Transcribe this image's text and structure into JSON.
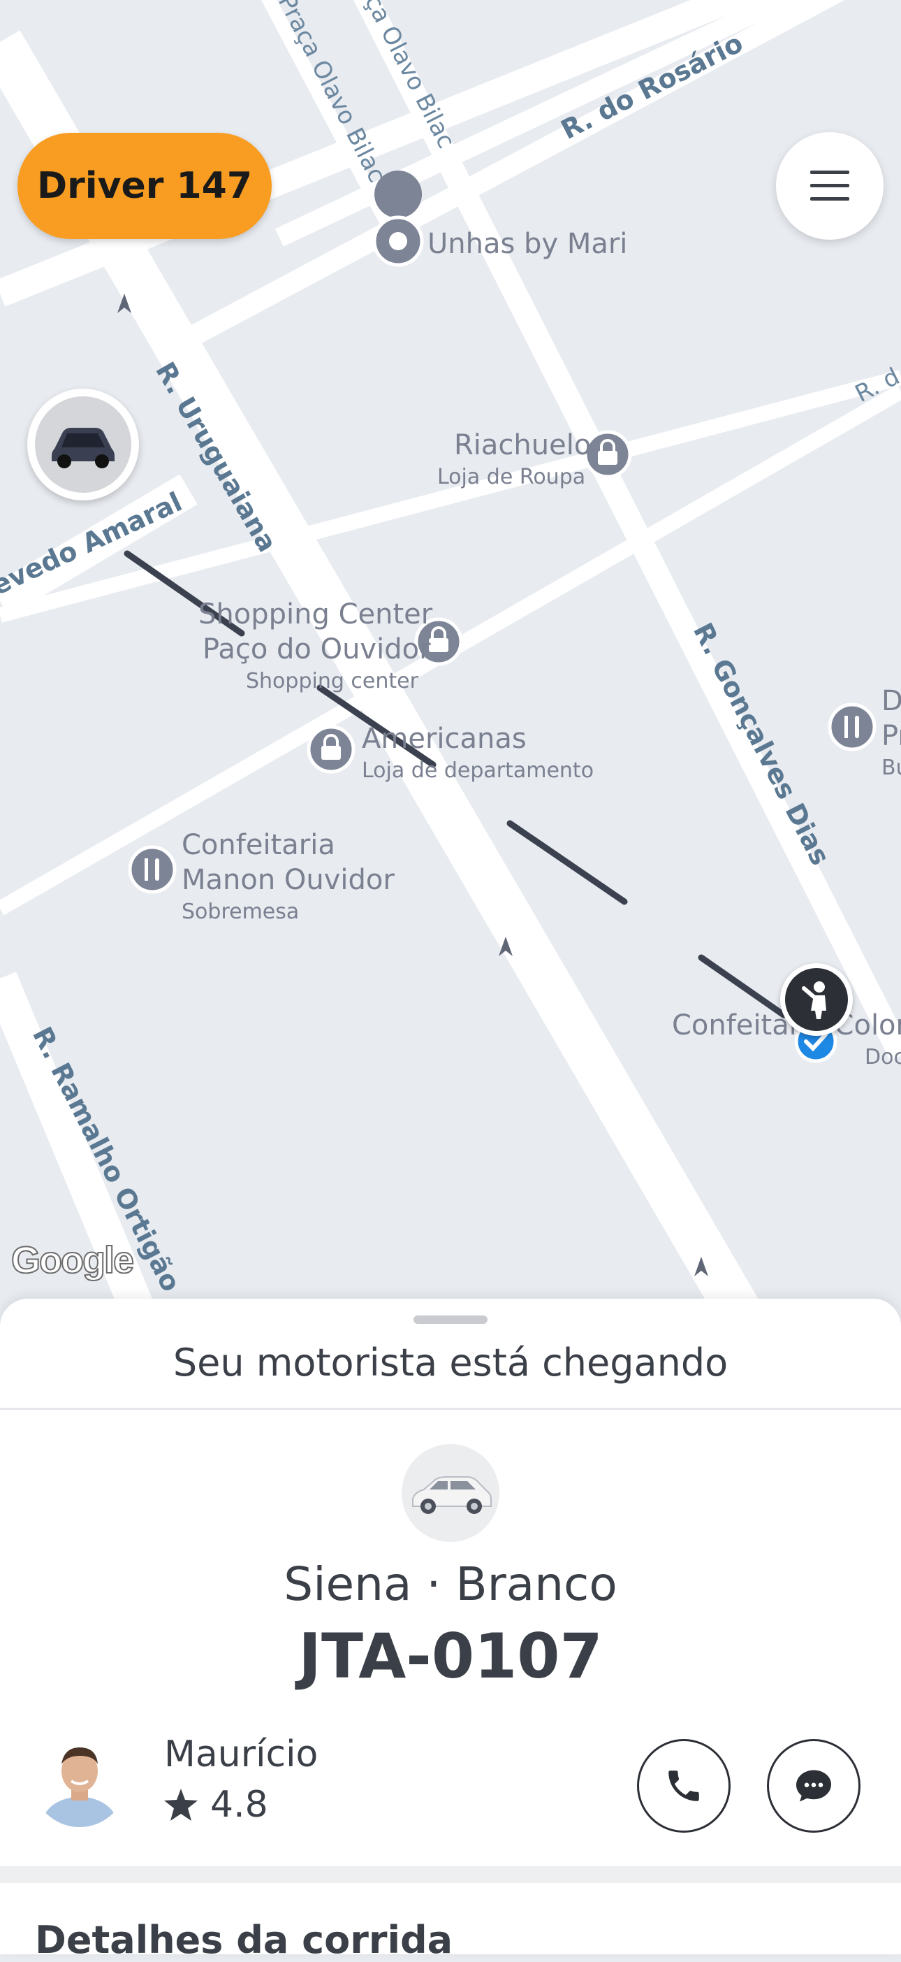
{
  "header": {
    "driver_badge": "Driver 147",
    "menu_icon": "hamburger-menu-icon"
  },
  "map": {
    "streets": {
      "uruguaiana": "R. Uruguaiana",
      "rosario": "R. do Rosário",
      "praca_olavo_bilac_1": "Praça Olavo Bilac",
      "praca_olavo_bilac_2": "ça Olavo Bilac",
      "goncalves_dias": "R. Gonçalves Dias",
      "ramalho_ortigao": "R. Ramalho Ortigão",
      "quevedo_amaral": "evedo Amaral",
      "r_d": "R. d"
    },
    "pois": {
      "unhas": {
        "name": "Unhas by Mari"
      },
      "riachuelo": {
        "name": "Riachuelo",
        "sub": "Loja de Roupa"
      },
      "shopping": {
        "line1": "Shopping Center",
        "line2": "Paço do Ouvidor",
        "sub": "Shopping center"
      },
      "americanas": {
        "name": "Americanas",
        "sub": "Loja de departamento"
      },
      "manon": {
        "line1": "Confeitaria",
        "line2": "Manon Ouvidor",
        "sub": "Sobremesa"
      },
      "colombo": {
        "name": "Confeitaria Colombo",
        "sub": "Doc"
      },
      "edge_right": {
        "line1": "D",
        "line2": "Pr",
        "sub": "Bu"
      }
    },
    "google_logo": "Google",
    "icons": {
      "car_marker": "car-icon",
      "pickup_marker": "person-waving-icon",
      "check": "check-icon"
    }
  },
  "sheet": {
    "status": "Seu motorista está chegando",
    "vehicle": "Siena · Branco",
    "plate": "JTA-0107",
    "driver_name": "Maurício",
    "rating": "4.8",
    "rating_icon": "star-icon",
    "call_icon": "phone-icon",
    "chat_icon": "chat-bubble-icon",
    "details_title": "Detalhes da corrida"
  },
  "colors": {
    "accent": "#f89d21",
    "map_bg": "#e8ebf0",
    "road": "#ffffff",
    "route": "#3c4150",
    "poi_pin": "#7d8496",
    "street_label": "#5a7891",
    "dark_text": "#3b3f47",
    "check": "#1e88e5"
  }
}
